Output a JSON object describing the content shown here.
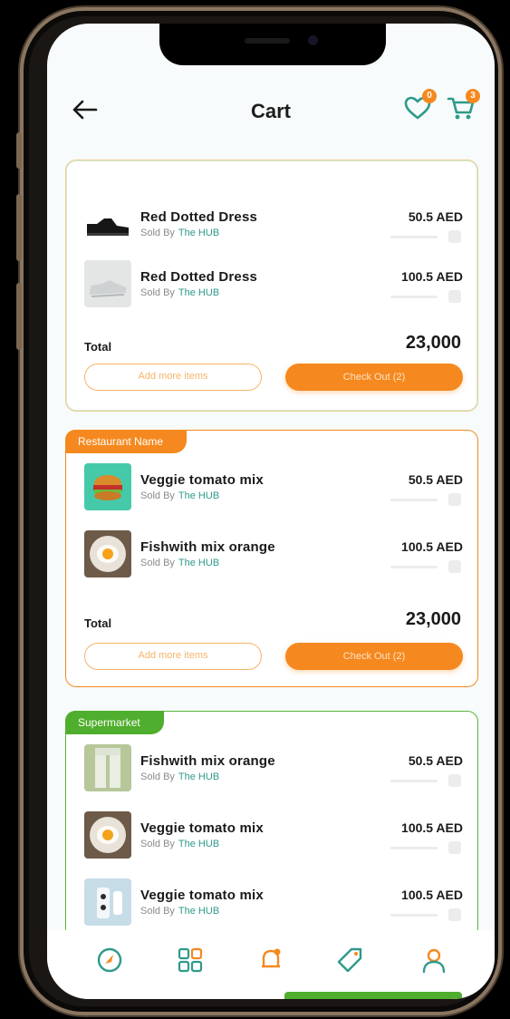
{
  "header": {
    "title": "Cart",
    "wishlist_count": "0",
    "cart_count": "3"
  },
  "groups": [
    {
      "tag": "",
      "items": [
        {
          "name": "Red Dotted Dress",
          "seller_prefix": "Sold By",
          "seller": "The HUB",
          "price": "50.5 AED"
        },
        {
          "name": "Red Dotted Dress",
          "seller_prefix": "Sold By",
          "seller": "The HUB",
          "price": "100.5 AED"
        }
      ],
      "total_label": "Total",
      "total_value": "23,000",
      "add_more_label": "Add more items",
      "checkout_label": "Check Out (2)"
    },
    {
      "tag": "Restaurant Name",
      "items": [
        {
          "name": "Veggie tomato mix",
          "seller_prefix": "Sold By",
          "seller": "The HUB",
          "price": "50.5 AED"
        },
        {
          "name": "Fishwith mix orange",
          "seller_prefix": "Sold By",
          "seller": "The HUB",
          "price": "100.5 AED"
        }
      ],
      "total_label": "Total",
      "total_value": "23,000",
      "add_more_label": "Add more items",
      "checkout_label": "Check Out (2)"
    },
    {
      "tag": "Supermarket",
      "items": [
        {
          "name": "Fishwith mix orange",
          "seller_prefix": "Sold By",
          "seller": "The HUB",
          "price": "50.5 AED"
        },
        {
          "name": "Veggie tomato mix",
          "seller_prefix": "Sold By",
          "seller": "The HUB",
          "price": "100.5 AED"
        },
        {
          "name": "Veggie tomato mix",
          "seller_prefix": "Sold By",
          "seller": "The HUB",
          "price": "100.5 AED"
        }
      ]
    }
  ],
  "nav": {
    "items": [
      "home-icon",
      "grid-icon",
      "bell-icon",
      "tag-icon",
      "profile-icon"
    ]
  },
  "colors": {
    "accent": "#f5891f",
    "green": "#4fae2d",
    "teal": "#2e9a8a"
  }
}
